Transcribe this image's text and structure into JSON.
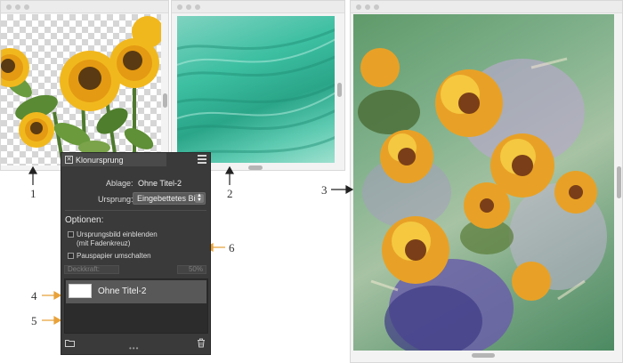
{
  "callouts": {
    "c1": "1",
    "c2": "2",
    "c3": "3",
    "c4": "4",
    "c5": "5",
    "c6": "6"
  },
  "panel": {
    "title": "Klonursprung",
    "ablage_label": "Ablage:",
    "ablage_value": "Ohne Titel-2",
    "ursprung_label": "Ursprung:",
    "ursprung_value": "Eingebettetes Bild",
    "optionen_label": "Optionen:",
    "option1_line1": "Ursprungsbild einblenden",
    "option1_line2": "(mit Fadenkreuz)",
    "option2": "Pauspapier umschalten",
    "opacity_label": "Deckkraft:",
    "opacity_value": "50%",
    "list_items": [
      {
        "label": "Ohne Titel-2"
      }
    ]
  },
  "icons": {
    "close": "close-icon",
    "menu": "menu-icon",
    "folder": "folder-icon",
    "trash": "trash-icon",
    "grip": "resize-grip-icon"
  },
  "colors": {
    "panel_bg": "#3a3a3a",
    "callout_arrow_orange": "#e8a23a",
    "callout_arrow_black": "#222222"
  }
}
